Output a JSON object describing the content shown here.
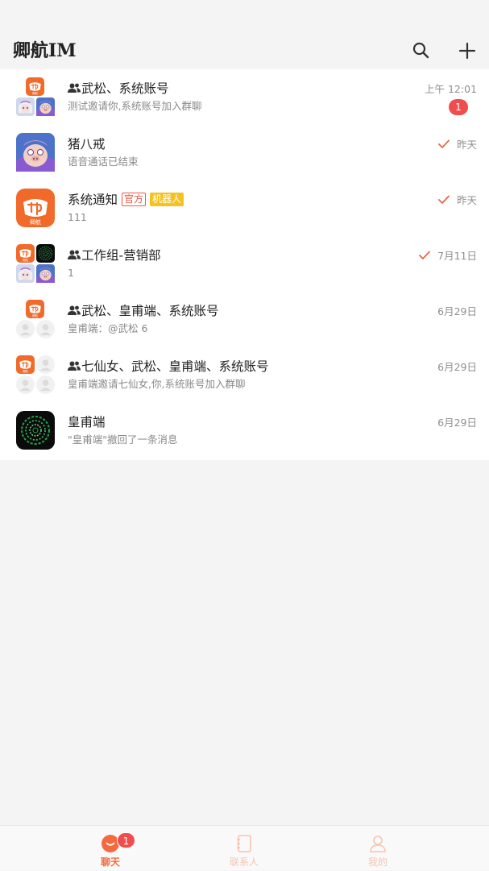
{
  "app": {
    "title": "卿航IM"
  },
  "header": {
    "search_icon": "search-icon",
    "add_icon": "plus-icon"
  },
  "conversations": [
    {
      "name": "武松、系统账号",
      "is_group": true,
      "preview": "测试邀请你,系统账号加入群聊",
      "time": "上午 12:01",
      "unread": "1",
      "read_check": false
    },
    {
      "name": "猪八戒",
      "is_group": false,
      "preview": "语音通话已结束",
      "time": "昨天",
      "read_check": true
    },
    {
      "name": "系统通知",
      "is_group": false,
      "tags": [
        "官方",
        "机器人"
      ],
      "preview": "111",
      "time": "昨天",
      "read_check": true
    },
    {
      "name": "工作组-营销部",
      "is_group": true,
      "preview": "1",
      "time": "7月11日",
      "read_check": true
    },
    {
      "name": "武松、皇甫端、系统账号",
      "is_group": true,
      "preview": "皇甫端：@武松 6",
      "time": "6月29日",
      "read_check": false
    },
    {
      "name": "七仙女、武松、皇甫端、系统账号",
      "is_group": true,
      "preview": "皇甫端邀请七仙女,你,系统账号加入群聊",
      "time": "6月29日",
      "read_check": false
    },
    {
      "name": "皇甫端",
      "is_group": false,
      "preview": "\"皇甫端\"撤回了一条消息",
      "time": "6月29日",
      "read_check": false
    }
  ],
  "tabbar": {
    "items": [
      {
        "label": "聊天",
        "icon": "chat-bubble-icon",
        "active": true,
        "badge": "1"
      },
      {
        "label": "联系人",
        "icon": "address-book-icon",
        "active": false
      },
      {
        "label": "我的",
        "icon": "person-icon",
        "active": false
      }
    ]
  },
  "colors": {
    "accent": "#f46a3e",
    "badge": "#f04e4e",
    "robot_tag": "#f5c220",
    "official_tag": "#e85a46"
  }
}
